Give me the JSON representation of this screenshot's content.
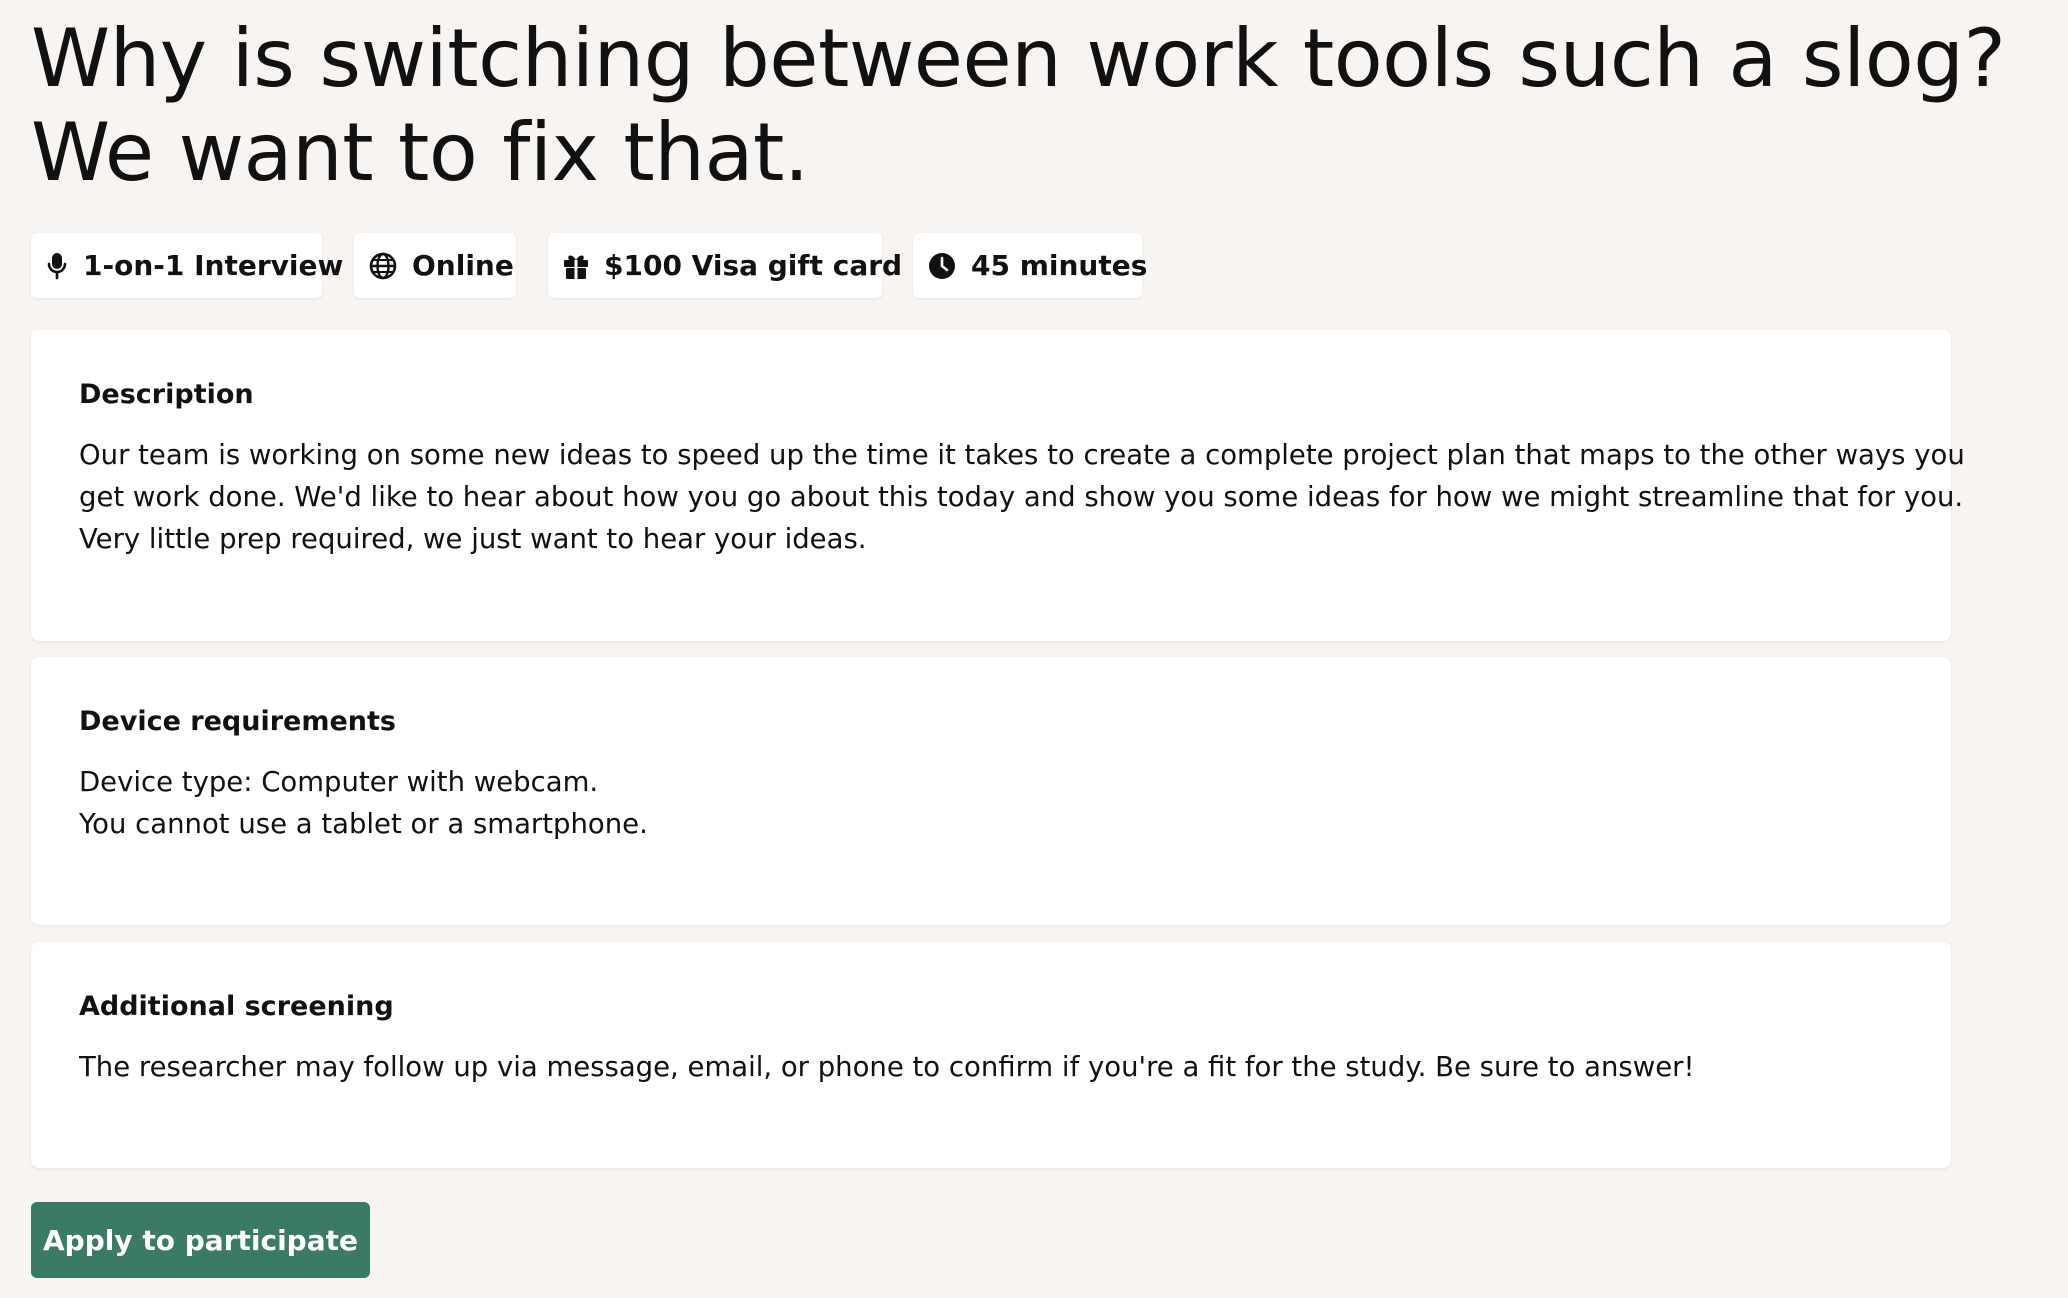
{
  "study": {
    "title_line1": "Why is switching between work tools such a slog?",
    "title_line2": "We want to fix that."
  },
  "chips": [
    {
      "icon": "microphone-icon",
      "label": "1-on-1 Interview"
    },
    {
      "icon": "globe-icon",
      "label": "Online"
    },
    {
      "icon": "gift-icon",
      "label": "$100 Visa gift card"
    },
    {
      "icon": "clock-icon",
      "label": "45 minutes"
    }
  ],
  "description": {
    "heading": "Description",
    "lines": [
      "Our team is working on some new ideas to speed up the time it takes to create a complete project plan that maps to the other ways you",
      "get work done. We'd like to hear about how you go about this today and show you some ideas for how we might streamline that for you.",
      "Very little prep required, we just want to hear your ideas."
    ]
  },
  "device": {
    "heading": "Device requirements",
    "lines": [
      "Device type: Computer with webcam.",
      "You cannot use a tablet or a smartphone."
    ]
  },
  "screening": {
    "heading": "Additional screening",
    "lines": [
      "The researcher may follow up via message, email, or phone to confirm if you're a fit for the study. Be sure to answer!"
    ]
  },
  "actions": {
    "apply_label": "Apply to participate"
  },
  "colors": {
    "background": "#f7f4f1",
    "card": "#ffffff",
    "button": "#3b7a66",
    "text": "#111111"
  }
}
